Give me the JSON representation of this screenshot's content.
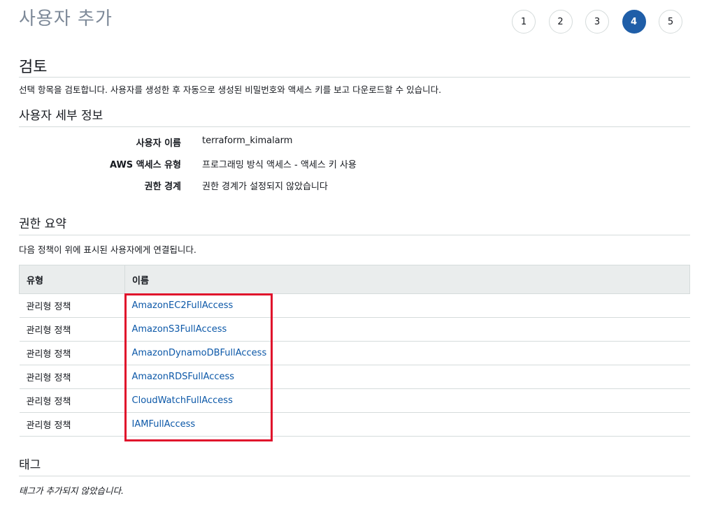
{
  "page": {
    "title": "사용자 추가"
  },
  "stepper": {
    "steps": [
      "1",
      "2",
      "3",
      "4",
      "5"
    ],
    "active_step": "4"
  },
  "review": {
    "heading": "검토",
    "description": "선택 항목을 검토합니다. 사용자를 생성한 후 자동으로 생성된 비밀번호와 액세스 키를 보고 다운로드할 수 있습니다."
  },
  "user_details": {
    "heading": "사용자 세부 정보",
    "rows": [
      {
        "label": "사용자 이름",
        "value": "terraform_kimalarm"
      },
      {
        "label": "AWS 액세스 유형",
        "value": "프로그래밍 방식 액세스 - 액세스 키 사용"
      },
      {
        "label": "권한 경계",
        "value": "권한 경계가 설정되지 않았습니다"
      }
    ]
  },
  "permissions": {
    "heading": "권한 요약",
    "description": "다음 정책이 위에 표시된 사용자에게 연결됩니다.",
    "columns": [
      "유형",
      "이름"
    ],
    "rows": [
      {
        "type": "관리형 정책",
        "name": "AmazonEC2FullAccess"
      },
      {
        "type": "관리형 정책",
        "name": "AmazonS3FullAccess"
      },
      {
        "type": "관리형 정책",
        "name": "AmazonDynamoDBFullAccess"
      },
      {
        "type": "관리형 정책",
        "name": "AmazonRDSFullAccess"
      },
      {
        "type": "관리형 정책",
        "name": "CloudWatchFullAccess"
      },
      {
        "type": "관리형 정책",
        "name": "IAMFullAccess"
      }
    ]
  },
  "tags": {
    "heading": "태그",
    "empty_text": "태그가 추가되지 않았습니다."
  },
  "colors": {
    "active_step": "#1f5ea8",
    "link": "#0c58a8",
    "highlight_annotation": "#e0102b",
    "table_header_bg": "#eaeded",
    "title_gray": "#7d8998"
  }
}
